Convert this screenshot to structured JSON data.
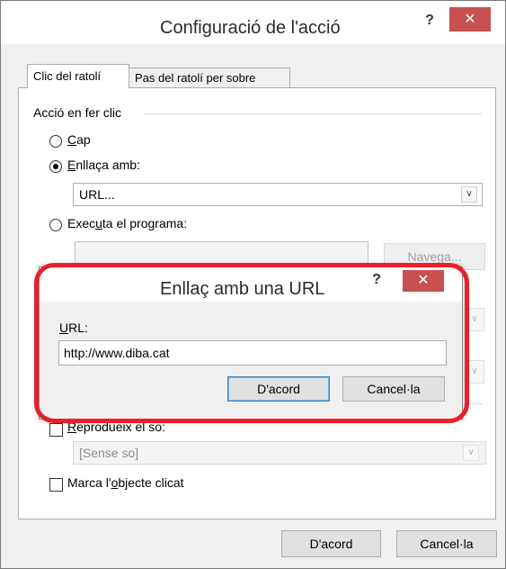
{
  "main_dialog": {
    "title": "Configuració de l'acció",
    "help_glyph": "?",
    "close_glyph": "✕",
    "tabs": [
      {
        "label": "Clic del ratolí"
      },
      {
        "label": "Pas del ratolí per sobre"
      }
    ],
    "group_label": "Acció en fer clic",
    "radio_none": {
      "label": "Cap",
      "accel": "C",
      "rest": "ap"
    },
    "radio_link": {
      "label": "Enllaça amb:",
      "accel": "E",
      "rest": "nllaça amb:"
    },
    "link_select": {
      "value": "URL..."
    },
    "radio_run": {
      "label": "Executa el programa:",
      "prefix": "Exec",
      "accel": "u",
      "rest": "ta el programa:"
    },
    "browse_button": {
      "label": "Navega..."
    },
    "play_sound": {
      "label": "Reprodueix el so:",
      "accel": "R",
      "rest": "eprodueix el so:"
    },
    "sound_select": {
      "value": "[Sense so]"
    },
    "mark_object": {
      "label": "Marca l'objecte clicat",
      "prefix": "Marca l'",
      "accel": "o",
      "rest": "bjecte clicat"
    },
    "ok_label": "D'acord",
    "cancel_label": "Cancel·la"
  },
  "url_dialog": {
    "title": "Enllaç amb una URL",
    "help_glyph": "?",
    "close_glyph": "✕",
    "url_label_accel": "U",
    "url_label_rest": "RL:",
    "url_value": "http://www.diba.cat",
    "ok_label": "D'acord",
    "cancel_label": "Cancel·la"
  },
  "colors": {
    "highlight_ring": "#e8202a",
    "close_button": "#c75050",
    "selection_blue": "#3c7fb1"
  }
}
